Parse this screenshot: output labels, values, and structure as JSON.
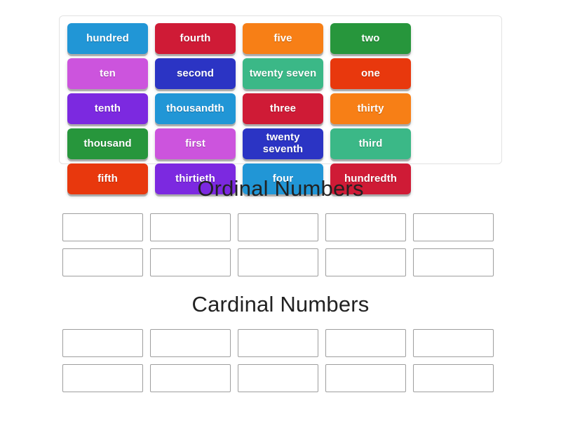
{
  "activity": {
    "type": "group-sort"
  },
  "tile_pool": {
    "name": "word-tile-pool",
    "tiles": [
      {
        "label": "hundred",
        "color": "#2196d6",
        "lines": 1
      },
      {
        "label": "fourth",
        "color": "#cf1b36",
        "lines": 1
      },
      {
        "label": "five",
        "color": "#f77f16",
        "lines": 1
      },
      {
        "label": "two",
        "color": "#27963c",
        "lines": 1
      },
      {
        "label": "ten",
        "color": "#cc54dd",
        "lines": 1
      },
      {
        "label": "second",
        "color": "#2b34c4",
        "lines": 1
      },
      {
        "label": "twenty seven",
        "color": "#3bb887",
        "lines": 1
      },
      {
        "label": "one",
        "color": "#e8380d",
        "lines": 1
      },
      {
        "label": "tenth",
        "color": "#7c29e0",
        "lines": 1
      },
      {
        "label": "thousandth",
        "color": "#2196d6",
        "lines": 1
      },
      {
        "label": "three",
        "color": "#cf1b36",
        "lines": 1
      },
      {
        "label": "thirty",
        "color": "#f77f16",
        "lines": 1
      },
      {
        "label": "thousand",
        "color": "#27963c",
        "lines": 1
      },
      {
        "label": "first",
        "color": "#cc54dd",
        "lines": 1
      },
      {
        "label": "twenty seventh",
        "color": "#2b34c4",
        "lines": 2
      },
      {
        "label": "third",
        "color": "#3bb887",
        "lines": 1
      },
      {
        "label": "fifth",
        "color": "#e8380d",
        "lines": 1
      },
      {
        "label": "thirtieth",
        "color": "#7c29e0",
        "lines": 1
      },
      {
        "label": "four",
        "color": "#2196d6",
        "lines": 1
      },
      {
        "label": "hundredth",
        "color": "#cf1b36",
        "lines": 1
      }
    ]
  },
  "categories": [
    {
      "title": "Ordinal Numbers",
      "slot_count": 10,
      "slots": [
        "",
        "",
        "",
        "",
        "",
        "",
        "",
        "",
        "",
        ""
      ]
    },
    {
      "title": "Cardinal Numbers",
      "slot_count": 10,
      "slots": [
        "",
        "",
        "",
        "",
        "",
        "",
        "",
        "",
        "",
        ""
      ]
    }
  ],
  "colors": {
    "background": "#ffffff",
    "pool_border": "#e2e2e2",
    "slot_border": "#9e9e9e",
    "title_text": "#222222",
    "tile_text": "#ffffff"
  }
}
